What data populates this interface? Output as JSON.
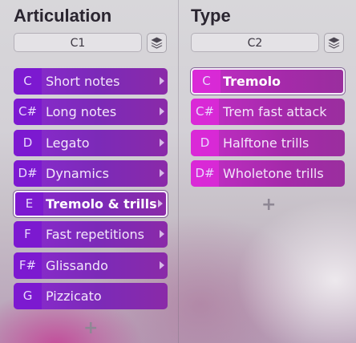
{
  "articulation": {
    "title": "Articulation",
    "selector_value": "C1",
    "add_label": "+",
    "items": [
      {
        "key": "C",
        "label": "Short notes",
        "has_submenu": true,
        "selected": false
      },
      {
        "key": "C#",
        "label": "Long notes",
        "has_submenu": true,
        "selected": false
      },
      {
        "key": "D",
        "label": "Legato",
        "has_submenu": true,
        "selected": false
      },
      {
        "key": "D#",
        "label": "Dynamics",
        "has_submenu": true,
        "selected": false
      },
      {
        "key": "E",
        "label": "Tremolo & trills",
        "has_submenu": true,
        "selected": true
      },
      {
        "key": "F",
        "label": "Fast repetitions",
        "has_submenu": true,
        "selected": false
      },
      {
        "key": "F#",
        "label": "Glissando",
        "has_submenu": true,
        "selected": false
      },
      {
        "key": "G",
        "label": "Pizzicato",
        "has_submenu": false,
        "selected": false
      }
    ]
  },
  "type": {
    "title": "Type",
    "selector_value": "C2",
    "add_label": "+",
    "items": [
      {
        "key": "C",
        "label": "Tremolo",
        "selected": true
      },
      {
        "key": "C#",
        "label": "Trem fast attack",
        "selected": false
      },
      {
        "key": "D",
        "label": "Halftone trills",
        "selected": false
      },
      {
        "key": "D#",
        "label": "Wholetone trills",
        "selected": false
      }
    ]
  },
  "icons": {
    "layers": "layers-icon",
    "submenu": "chevron-right-icon",
    "add": "plus-icon"
  }
}
